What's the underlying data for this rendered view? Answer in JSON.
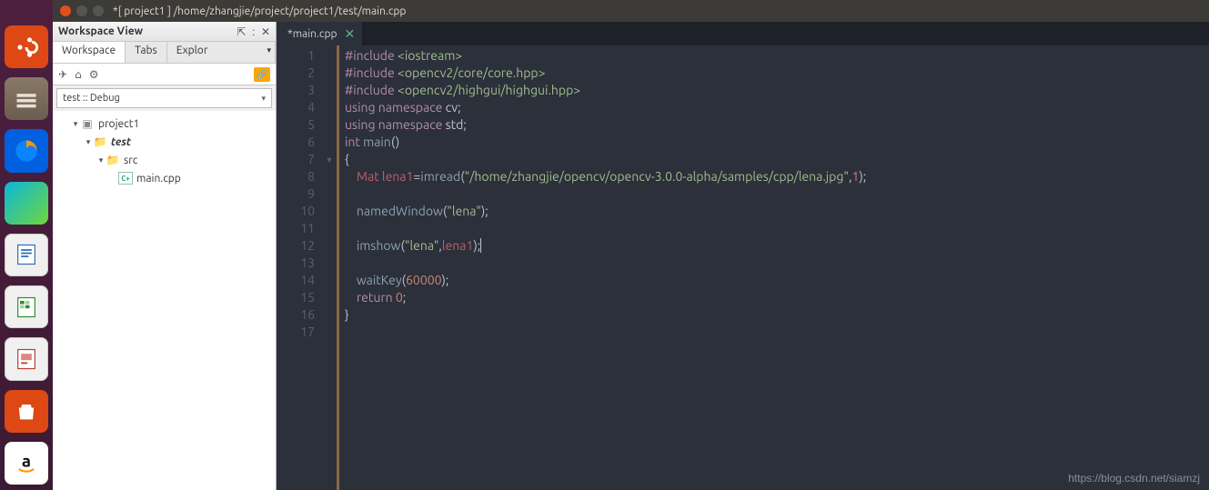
{
  "window": {
    "title": "*[ project1 ] /home/zhangjie/project/project1/test/main.cpp"
  },
  "launcher": {
    "items": [
      {
        "name": "ubuntu-dash",
        "label": "Dash"
      },
      {
        "name": "files",
        "label": "Files"
      },
      {
        "name": "firefox",
        "label": "Firefox"
      },
      {
        "name": "windows-tile",
        "label": "Tiles"
      },
      {
        "name": "writer",
        "label": "Writer"
      },
      {
        "name": "calc",
        "label": "Calc"
      },
      {
        "name": "impress",
        "label": "Impress"
      },
      {
        "name": "software",
        "label": "Software"
      },
      {
        "name": "amazon",
        "label": "Amazon"
      }
    ]
  },
  "sidebar": {
    "panel_title": "Workspace View",
    "tabs": {
      "workspace": "Workspace",
      "tabs": "Tabs",
      "explorer": "Explor"
    },
    "combo_value": "test :: Debug",
    "tree": {
      "root": "project1",
      "folder1": "test",
      "folder2": "src",
      "file1": "main.cpp"
    }
  },
  "editor": {
    "tab_label": "*main.cpp",
    "lines": [
      "1",
      "2",
      "3",
      "4",
      "5",
      "6",
      "7",
      "8",
      "9",
      "10",
      "11",
      "12",
      "13",
      "14",
      "15",
      "16",
      "17"
    ],
    "code": {
      "l1": {
        "inc": "#include",
        "arg": "<iostream>"
      },
      "l2": {
        "inc": "#include",
        "arg": "<opencv2/core/core.hpp>"
      },
      "l3": {
        "inc": "#include",
        "arg": "<opencv2/highgui/highgui.hpp>"
      },
      "l4": {
        "kw": "using namespace",
        "ns": "cv",
        ";": ";"
      },
      "l5": {
        "kw": "using namespace",
        "ns": "std",
        ";": ";"
      },
      "l6": {
        "t": "int",
        "fn": "main",
        "p": "()"
      },
      "l7": "{",
      "l8": {
        "pad": "    ",
        "id": "Mat lena1",
        "eq": "=",
        "fn": "imread",
        "paren": "(",
        "str": "\"/home/zhangjie/opencv/opencv-3.0.0-alpha/samples/cpp/lena.jpg\"",
        ",": ",",
        "num": "1",
        "end": ");"
      },
      "l10": {
        "pad": "    ",
        "fn": "namedWindow",
        "paren": "(",
        "str": "\"lena\"",
        "end": ");"
      },
      "l12": {
        "pad": "    ",
        "fn": "imshow",
        "paren": "(",
        "str": "\"lena\"",
        ",": ",",
        "id": "lena1",
        "end": ");"
      },
      "l14": {
        "pad": "    ",
        "fn": "waitKey",
        "paren": "(",
        "num": "60000",
        "end": ");"
      },
      "l15": {
        "pad": "    ",
        "kw": "return",
        "sp": " ",
        "num": "0",
        ";": ";"
      },
      "l16": "}"
    }
  },
  "watermark": "https://blog.csdn.net/siamzj"
}
